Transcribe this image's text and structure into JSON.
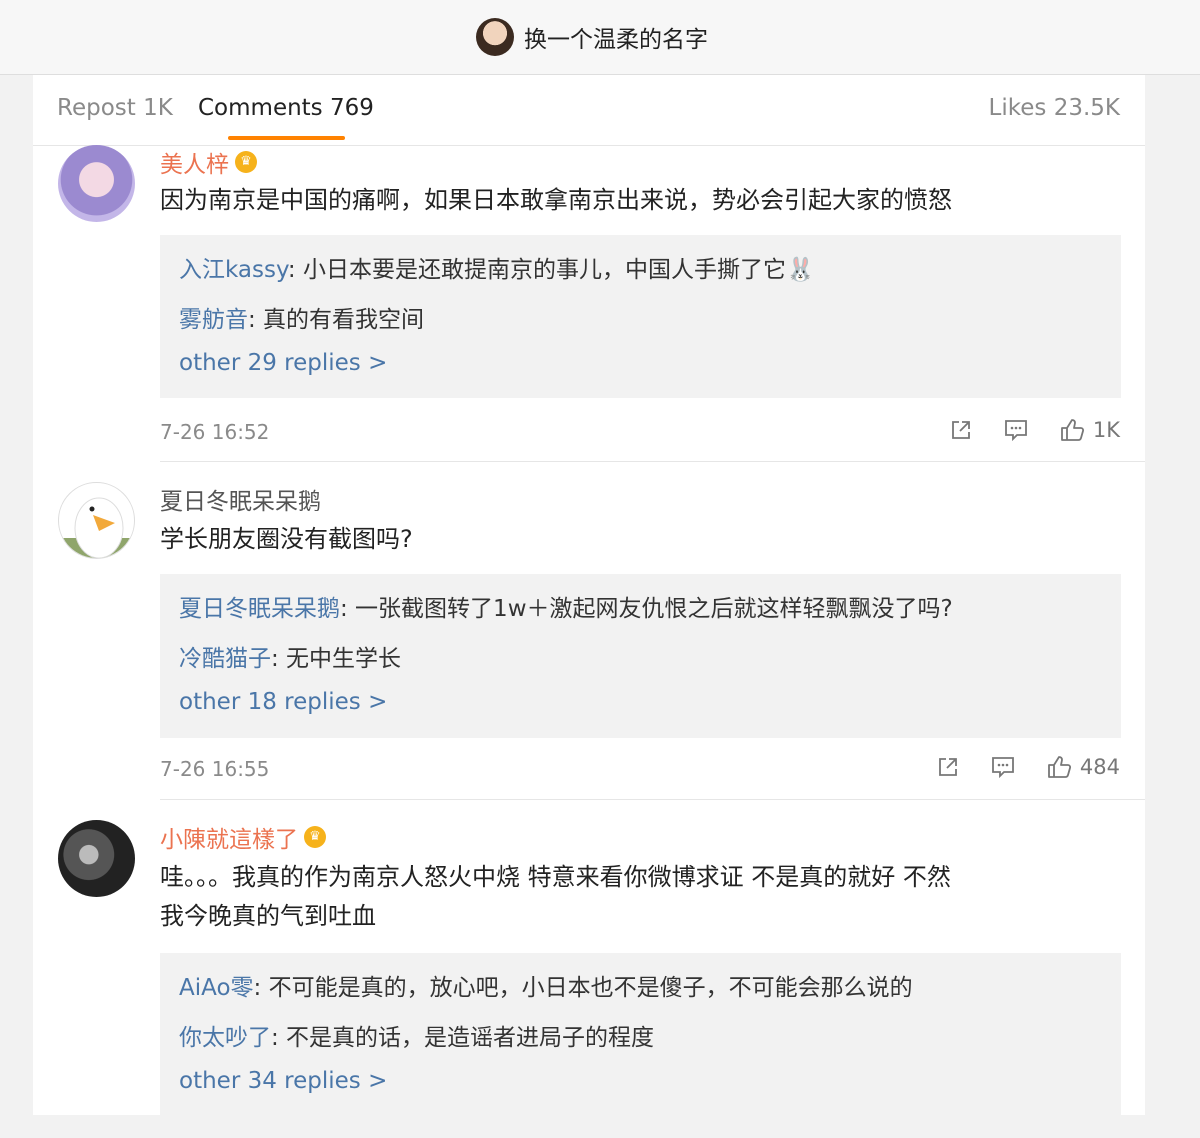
{
  "header": {
    "title": "换一个温柔的名字"
  },
  "tabs": {
    "repost": "Repost 1K",
    "comments": "Comments 769",
    "likes": "Likes 23.5K"
  },
  "accent_color": "#ff8200",
  "link_color": "#4a76a8",
  "comments": [
    {
      "user": "美人梓",
      "vip": true,
      "text": "因为南京是中国的痛啊，如果日本敢拿南京出来说，势必会引起大家的愤怒",
      "replies": [
        {
          "name": "入江kassy",
          "text": ": 小日本要是还敢提南京的事儿，中国人手撕了它🐰"
        },
        {
          "name": "雾舫音",
          "text": ": 真的有看我空间"
        }
      ],
      "more": "other 29 replies >",
      "time": "7-26 16:52",
      "likes": "1K"
    },
    {
      "user": "夏日冬眠呆呆鹅",
      "vip": false,
      "text": "学长朋友圈没有截图吗?",
      "replies": [
        {
          "name": "夏日冬眠呆呆鹅",
          "text": ": 一张截图转了1w＋激起网友仇恨之后就这样轻飘飘没了吗?"
        },
        {
          "name": "冷酷猫子",
          "text": ": 无中生学长"
        }
      ],
      "more": "other 18 replies >",
      "time": "7-26 16:55",
      "likes": "484"
    },
    {
      "user": "小陳就這樣了",
      "vip": true,
      "text_line1": "哇。。。我真的作为南京人怒火中烧 特意来看你微博求证 不是真的就好 不然",
      "text_line2": "我今晚真的气到吐血",
      "replies": [
        {
          "name": "AiAo零",
          "text": ": 不可能是真的，放心吧，小日本也不是傻子，不可能会那么说的"
        },
        {
          "name": "你太吵了",
          "text": ": 不是真的话，是造谣者进局子的程度"
        }
      ],
      "more": "other 34 replies >"
    }
  ]
}
